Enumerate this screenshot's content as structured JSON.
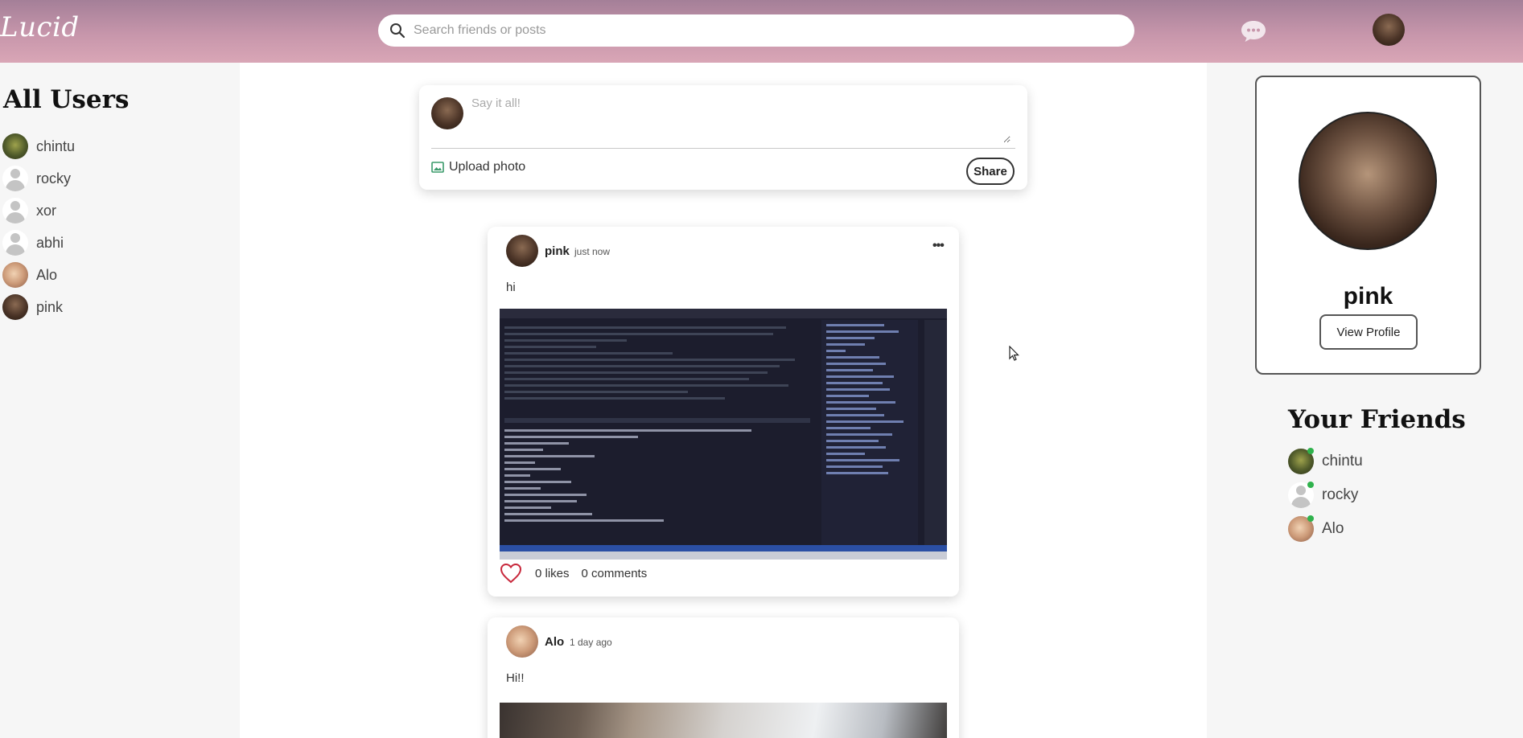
{
  "app": {
    "logo": "Lucid"
  },
  "search": {
    "placeholder": "Search friends or posts",
    "value": ""
  },
  "header": {
    "chat_icon": "chat-bubble-icon",
    "avatar_icon": "user-avatar"
  },
  "left_sidebar": {
    "title": "All Users",
    "users": [
      {
        "name": "chintu",
        "avatar": "green-photo"
      },
      {
        "name": "rocky",
        "avatar": "default-silhouette"
      },
      {
        "name": "xor",
        "avatar": "default-silhouette"
      },
      {
        "name": "abhi",
        "avatar": "default-silhouette"
      },
      {
        "name": "Alo",
        "avatar": "warm-photo"
      },
      {
        "name": "pink",
        "avatar": "dark-photo"
      }
    ]
  },
  "composer": {
    "placeholder": "Say it all!",
    "value": "",
    "upload_label": "Upload photo",
    "share_label": "Share"
  },
  "posts": [
    {
      "author": "pink",
      "time": "just now",
      "text": "hi",
      "image": "code-editor-screenshot",
      "likes_label": "0 likes",
      "comments_label": "0 comments",
      "liked": false
    },
    {
      "author": "Alo",
      "time": "1 day ago",
      "text": "Hi!!",
      "image": "room-photo"
    }
  ],
  "profile": {
    "name": "pink",
    "view_label": "View Profile"
  },
  "friends": {
    "title": "Your Friends",
    "items": [
      {
        "name": "chintu",
        "online": true
      },
      {
        "name": "rocky",
        "online": true
      },
      {
        "name": "Alo",
        "online": true
      }
    ]
  },
  "colors": {
    "header_top": "#a47f98",
    "header_bottom": "#d9a6b6",
    "heart": "#c8283c",
    "online": "#2fb24c"
  }
}
